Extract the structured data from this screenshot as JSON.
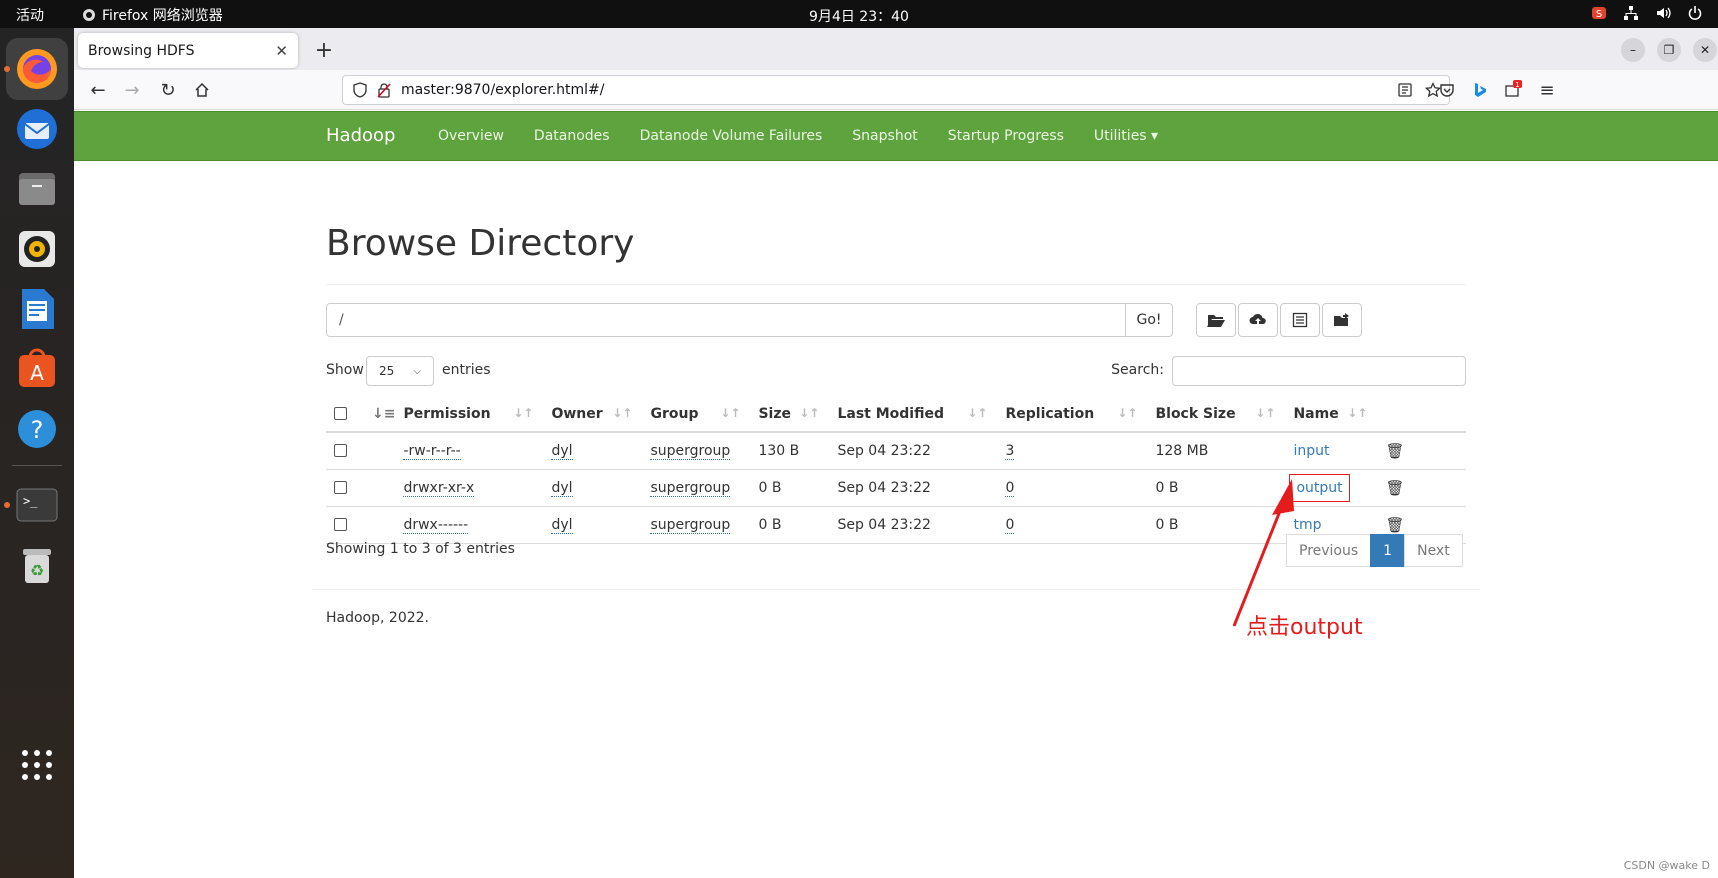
{
  "topbar": {
    "activities": "活动",
    "app_name": "Firefox 网络浏览器",
    "clock": "9月4日  23：40",
    "tray": [
      "csdn-icon",
      "network-icon",
      "volume-icon",
      "power-icon"
    ]
  },
  "dock": {
    "apps": [
      "firefox-icon",
      "thunderbird-icon",
      "files-icon",
      "rhythmbox-icon",
      "writer-icon",
      "app-center-icon",
      "help-icon",
      "terminal-icon",
      "trash-icon",
      "app-grid-icon"
    ]
  },
  "browser": {
    "tab_title": "Browsing HDFS",
    "url": "master:9870/explorer.html#/"
  },
  "hadoop_nav": {
    "brand": "Hadoop",
    "links": [
      "Overview",
      "Datanodes",
      "Datanode Volume Failures",
      "Snapshot",
      "Startup Progress",
      "Utilities ▾"
    ],
    "color": "#5fa33e"
  },
  "main": {
    "title": "Browse Directory",
    "path_value": "/",
    "go_label": "Go!",
    "show_label": "Show",
    "entries_count": "25",
    "entries_label": "entries",
    "search_label": "Search:",
    "columns": [
      "Permission",
      "Owner",
      "Group",
      "Size",
      "Last Modified",
      "Replication",
      "Block Size",
      "Name"
    ],
    "rows": [
      {
        "permission": "-rw-r--r--",
        "owner": "dyl",
        "group": "supergroup",
        "size": "130 B",
        "modified": "Sep 04 23:22",
        "replication": "3",
        "block_size": "128 MB",
        "name": "input"
      },
      {
        "permission": "drwxr-xr-x",
        "owner": "dyl",
        "group": "supergroup",
        "size": "0 B",
        "modified": "Sep 04 23:22",
        "replication": "0",
        "block_size": "0 B",
        "name": "output"
      },
      {
        "permission": "drwx------",
        "owner": "dyl",
        "group": "supergroup",
        "size": "0 B",
        "modified": "Sep 04 23:22",
        "replication": "0",
        "block_size": "0 B",
        "name": "tmp"
      }
    ],
    "info": "Showing 1 to 3 of 3 entries",
    "pager": {
      "previous": "Previous",
      "current": "1",
      "next": "Next"
    },
    "footer": "Hadoop, 2022."
  },
  "annotation": {
    "text": "点击output",
    "color": "#e51c1c"
  },
  "watermark": "CSDN @wake D"
}
